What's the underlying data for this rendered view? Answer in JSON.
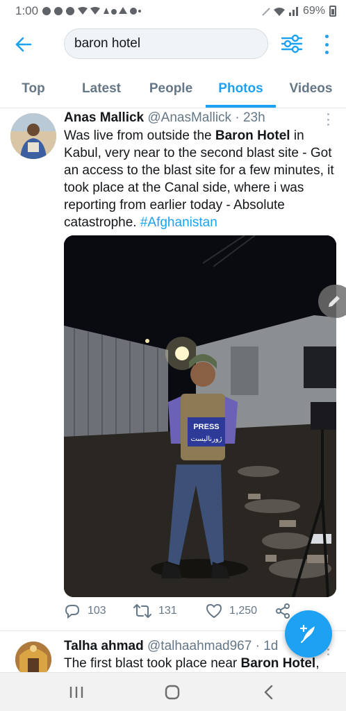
{
  "status_bar": {
    "time": "1:00",
    "battery": "69%"
  },
  "search": {
    "query": "baron hotel"
  },
  "tabs": [
    {
      "label": "Top"
    },
    {
      "label": "Latest"
    },
    {
      "label": "People"
    },
    {
      "label": "Photos",
      "active": true
    },
    {
      "label": "Videos"
    }
  ],
  "tweet": {
    "name": "Anas Mallick",
    "handle": "@AnasMallick",
    "separator": " · ",
    "time": "23h",
    "text_parts": {
      "p1": "Was live from outside the ",
      "b1": "Baron Hotel",
      "p2": " in Kabul, very near to the second blast site - Got an access to the blast site for a few minutes, it took place at the Canal side, where i was reporting from earlier today - Absolute catastrophe. ",
      "hashtag": "#Afghanistan"
    },
    "press_label": "PRESS",
    "press_sub": "ژورنالیست",
    "stats": {
      "replies": "103",
      "retweets": "131",
      "likes": "1,250"
    }
  },
  "tweet2": {
    "name": "Talha ahmad",
    "handle": "@talhaahmad967",
    "separator": " · ",
    "time": "1d",
    "text_p1": "The first blast took place near ",
    "text_b1": "Baron Hotel",
    "text_p2": ","
  },
  "colors": {
    "accent": "#1da1f2",
    "muted": "#657786"
  }
}
